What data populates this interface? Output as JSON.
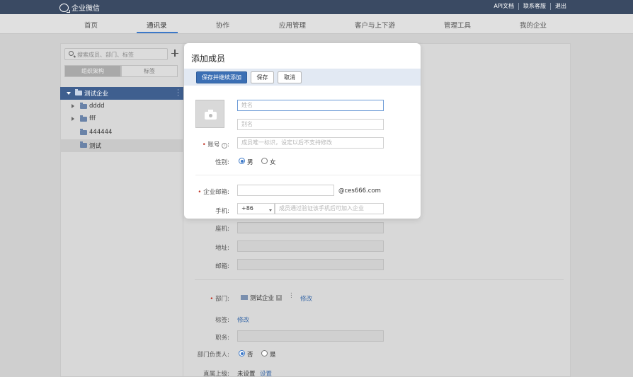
{
  "app": {
    "name": "企业微信"
  },
  "toplinks": [
    "API文档",
    "联系客服",
    "退出"
  ],
  "nav": [
    {
      "label": "首页"
    },
    {
      "label": "通讯录",
      "active": true
    },
    {
      "label": "协作"
    },
    {
      "label": "应用管理"
    },
    {
      "label": "客户与上下游"
    },
    {
      "label": "管理工具"
    },
    {
      "label": "我的企业"
    }
  ],
  "sidebar": {
    "search_placeholder": "搜索成员、部门、标签",
    "segments": [
      "组织架构",
      "标签"
    ],
    "tree": [
      {
        "label": "测试企业",
        "selected": true
      },
      {
        "label": "dddd"
      },
      {
        "label": "fff"
      },
      {
        "label": "444444"
      },
      {
        "label": "测试"
      }
    ]
  },
  "dialog": {
    "title": "添加成员",
    "buttons": {
      "save_continue": "保存并继续添加",
      "save": "保存",
      "cancel": "取消"
    },
    "fields": {
      "name_placeholder": "姓名",
      "alias_placeholder": "别名",
      "account_label": "账号",
      "account_placeholder": "成员唯一标识，设定以后不支持修改",
      "gender_label": "性别:",
      "gender_male": "男",
      "gender_female": "女",
      "email_label": "企业邮箱:",
      "email_domain": "@ces666.com",
      "mobile_label": "手机:",
      "country_code": "+86",
      "mobile_placeholder": "成员通过验证该手机后可加入企业"
    }
  },
  "background_form": {
    "landline_label": "座机:",
    "address_label": "地址:",
    "mail_label": "邮箱:",
    "department_label": "部门:",
    "department_value": "测试企业",
    "department_modify": "修改",
    "tag_label": "标签:",
    "tag_modify": "修改",
    "position_label": "职务:",
    "head_label": "部门负责人:",
    "head_no": "否",
    "head_yes": "是",
    "superior_label": "直属上级:",
    "superior_value": "未设置",
    "superior_set": "设置"
  },
  "colors": {
    "topbar": "#3a4a63",
    "primary": "#3b6fb4",
    "selected_tree": "#3f5f8f"
  }
}
